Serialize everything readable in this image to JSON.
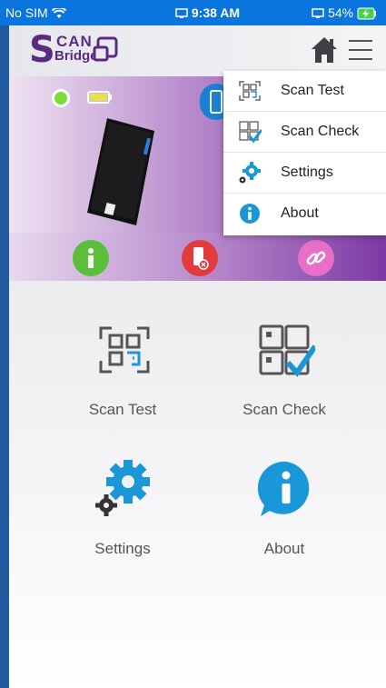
{
  "status_bar": {
    "carrier": "No SIM",
    "time": "9:38 AM",
    "battery": "54%"
  },
  "app": {
    "logo_letter": "S",
    "logo_line1": "CAN",
    "logo_line2": "Bridge"
  },
  "dropdown": {
    "items": [
      {
        "label": "Scan Test"
      },
      {
        "label": "Scan Check"
      },
      {
        "label": "Settings"
      },
      {
        "label": "About"
      }
    ]
  },
  "grid": {
    "tiles": [
      {
        "label": "Scan Test"
      },
      {
        "label": "Scan Check"
      },
      {
        "label": "Settings"
      },
      {
        "label": "About"
      }
    ]
  },
  "colors": {
    "accent_blue": "#1a97d8",
    "brand_purple": "#5b2a83",
    "status_green": "#7ddc3b"
  },
  "icons": {
    "scan_test": "qr-scan-icon",
    "scan_check": "scan-check-icon",
    "settings": "gears-icon",
    "about": "info-bubble-icon"
  }
}
